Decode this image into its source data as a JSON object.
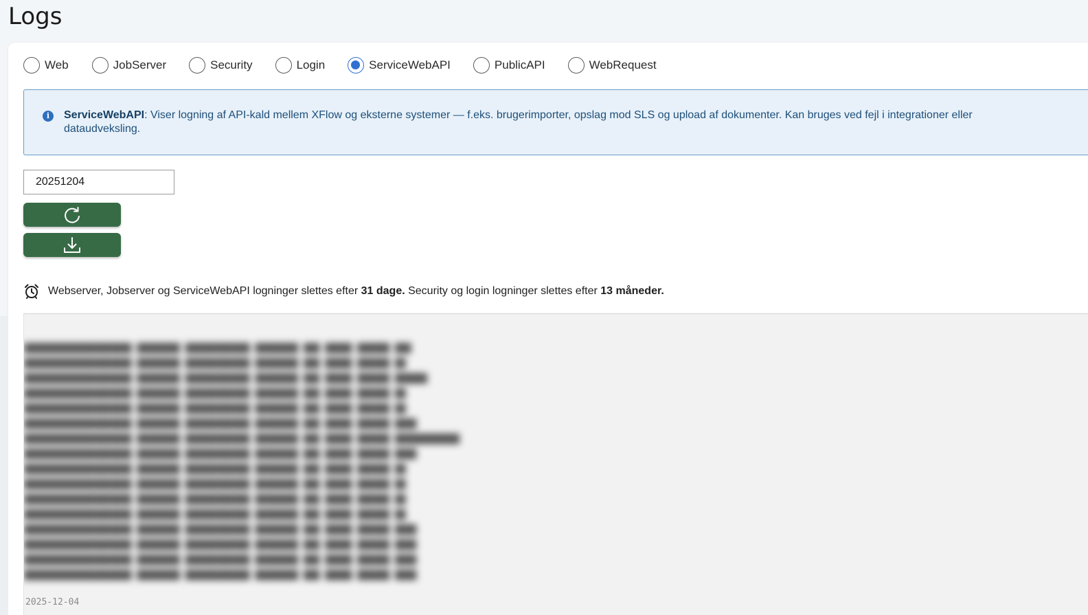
{
  "page": {
    "title": "Logs"
  },
  "log_types": {
    "options": [
      {
        "label": "Web",
        "checked": false
      },
      {
        "label": "JobServer",
        "checked": false
      },
      {
        "label": "Security",
        "checked": false
      },
      {
        "label": "Login",
        "checked": false
      },
      {
        "label": "ServiceWebAPI",
        "checked": true
      },
      {
        "label": "PublicAPI",
        "checked": false
      },
      {
        "label": "WebRequest",
        "checked": false
      }
    ]
  },
  "info": {
    "icon": "info-circle-icon",
    "title": "ServiceWebAPI",
    "text": ": Viser logning af API-kald mellem XFlow og eksterne systemer — f.eks. brugerimporter, opslag mod SLS og upload af dokumenter. Kan bruges ved fejl i integrationer eller dataudveksling."
  },
  "date_filter": {
    "value": "20251204"
  },
  "buttons": {
    "refresh_icon": "refresh-icon",
    "download_icon": "download-icon"
  },
  "retention": {
    "icon": "alarm-clock-icon",
    "part1": "Webserver, Jobserver og ServiceWebAPI logninger slettes efter ",
    "bold1": "31 dage.",
    "part2": " Security og login logninger slettes efter ",
    "bold2": "13 måneder."
  },
  "log": {
    "visible_prefix": "2025-12-04"
  },
  "colors": {
    "accent": "#2f6fd1",
    "button": "#376b46",
    "info_bg": "#e8f1f9",
    "info_border": "#6a9cc6"
  }
}
